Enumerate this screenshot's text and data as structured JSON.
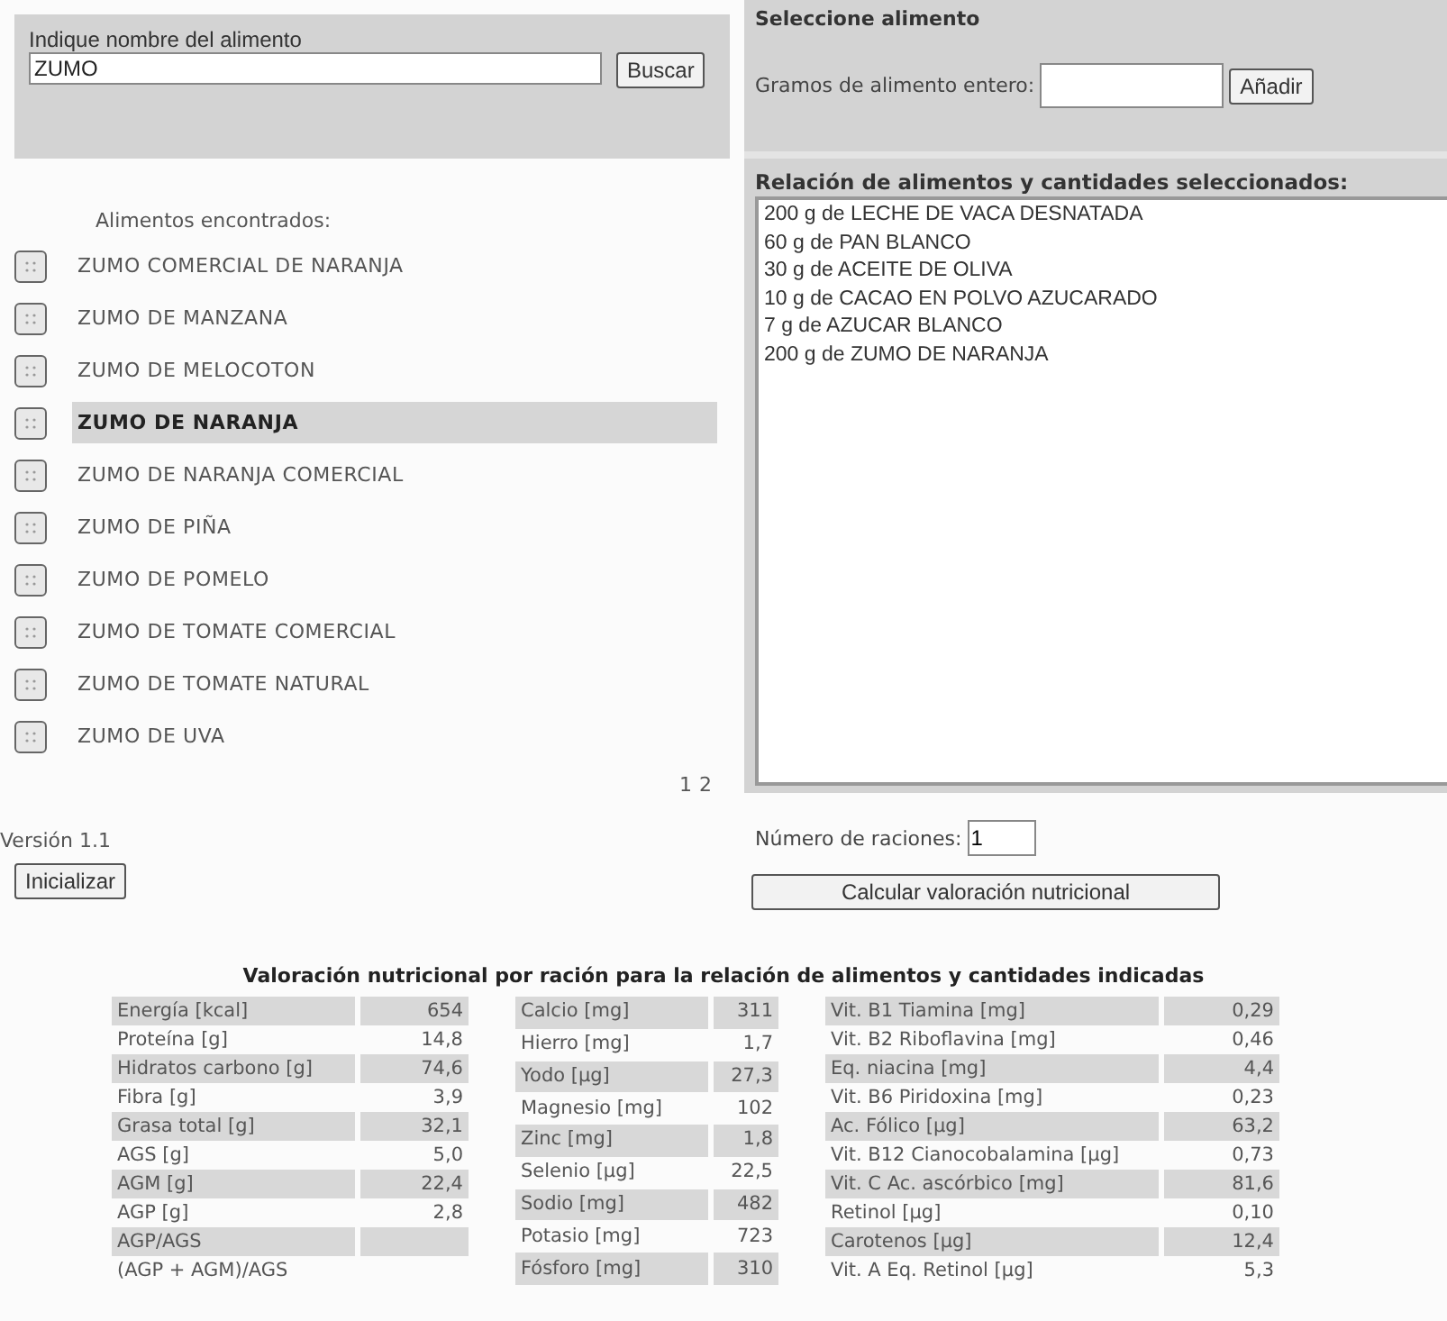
{
  "search": {
    "label": "Indique nombre del alimento",
    "value": "ZUMO",
    "button": "Buscar"
  },
  "results": {
    "label": "Alimentos encontrados:",
    "items": [
      {
        "name": "ZUMO COMERCIAL DE NARANJA",
        "selected": false
      },
      {
        "name": "ZUMO DE MANZANA",
        "selected": false
      },
      {
        "name": "ZUMO DE MELOCOTON",
        "selected": false
      },
      {
        "name": "ZUMO DE NARANJA",
        "selected": true
      },
      {
        "name": "ZUMO DE NARANJA COMERCIAL",
        "selected": false
      },
      {
        "name": "ZUMO DE PIÑA",
        "selected": false
      },
      {
        "name": "ZUMO DE POMELO",
        "selected": false
      },
      {
        "name": "ZUMO DE TOMATE COMERCIAL",
        "selected": false
      },
      {
        "name": "ZUMO DE TOMATE NATURAL",
        "selected": false
      },
      {
        "name": "ZUMO DE UVA",
        "selected": false
      }
    ],
    "pages": [
      "1",
      "2"
    ]
  },
  "version": "Versión 1.1",
  "init_button": "Inicializar",
  "select": {
    "title": "Seleccione alimento",
    "grams_label": "Gramos de alimento entero:",
    "add_button": "Añadir"
  },
  "selection": {
    "title": "Relación de alimentos y cantidades seleccionados:",
    "lines": [
      "200 g de LECHE DE VACA DESNATADA",
      "60 g de PAN BLANCO",
      "30 g de ACEITE DE OLIVA",
      "10 g de CACAO EN POLVO AZUCARADO",
      "7 g de AZUCAR BLANCO",
      "200 g de ZUMO DE NARANJA"
    ]
  },
  "servings": {
    "label": "Número de raciones:",
    "value": "1"
  },
  "calc_button": "Calcular valoración nutricional",
  "nutrition": {
    "title": "Valoración nutricional por ración para la relación de alimentos y cantidades indicadas",
    "tables": [
      {
        "rows": [
          {
            "label": "Energía [kcal]",
            "value": "654"
          },
          {
            "label": "Proteína [g]",
            "value": "14,8"
          },
          {
            "label": "Hidratos carbono [g]",
            "value": "74,6"
          },
          {
            "label": "Fibra [g]",
            "value": "3,9"
          },
          {
            "label": "Grasa total [g]",
            "value": "32,1"
          },
          {
            "label": "AGS [g]",
            "value": "5,0"
          },
          {
            "label": "AGM [g]",
            "value": "22,4"
          },
          {
            "label": "AGP [g]",
            "value": "2,8"
          },
          {
            "label": "AGP/AGS"
          },
          {
            "label": "(AGP + AGM)/AGS"
          }
        ]
      },
      {
        "rows": [
          {
            "label": "Calcio [mg]",
            "value": "311"
          },
          {
            "label": "Hierro [mg]",
            "value": "1,7"
          },
          {
            "label": "Yodo [µg]",
            "value": "27,3"
          },
          {
            "label": "Magnesio [mg]",
            "value": "102"
          },
          {
            "label": "Zinc [mg]",
            "value": "1,8"
          },
          {
            "label": "Selenio [µg]",
            "value": "22,5"
          },
          {
            "label": "Sodio [mg]",
            "value": "482"
          },
          {
            "label": "Potasio [mg]",
            "value": "723"
          },
          {
            "label": "Fósforo [mg]",
            "value": "310"
          }
        ]
      },
      {
        "rows": [
          {
            "label": "Vit. B1 Tiamina [mg]",
            "value": "0,29"
          },
          {
            "label": "Vit. B2 Riboflavina [mg]",
            "value": "0,46"
          },
          {
            "label": "Eq. niacina [mg]",
            "value": "4,4"
          },
          {
            "label": "Vit. B6 Piridoxina [mg]",
            "value": "0,23"
          },
          {
            "label": "Ac. Fólico [µg]",
            "value": "63,2"
          },
          {
            "label": "Vit. B12 Cianocobalamina [µg]",
            "value": "0,73"
          },
          {
            "label": "Vit. C Ac. ascórbico [mg]",
            "value": "81,6"
          },
          {
            "label": "Retinol [µg]",
            "value": "0,10"
          },
          {
            "label": "Carotenos [µg]",
            "value": "12,4"
          },
          {
            "label": "Vit. A Eq. Retinol [µg]",
            "value": "5,3"
          }
        ]
      }
    ]
  }
}
